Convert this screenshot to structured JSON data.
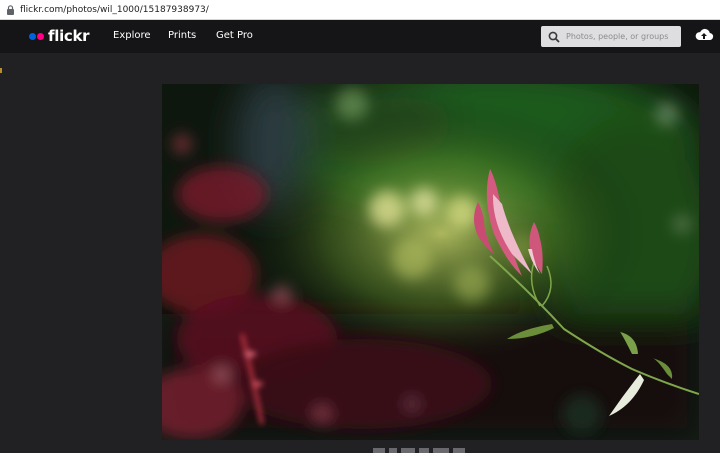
{
  "browser": {
    "url": "flickr.com/photos/wil_1000/15187938973/"
  },
  "nav": {
    "logo_text": "flickr",
    "links": [
      "Explore",
      "Prints",
      "Get Pro"
    ],
    "search_placeholder": "Photos, people, or groups"
  },
  "colors": {
    "flickr_blue": "#0063dc",
    "flickr_pink": "#ff0084",
    "nav_bg": "#151517",
    "page_bg": "#212124"
  },
  "icons": {
    "lock": "lock-icon",
    "search": "search-icon",
    "upload": "cloud-upload-icon"
  }
}
